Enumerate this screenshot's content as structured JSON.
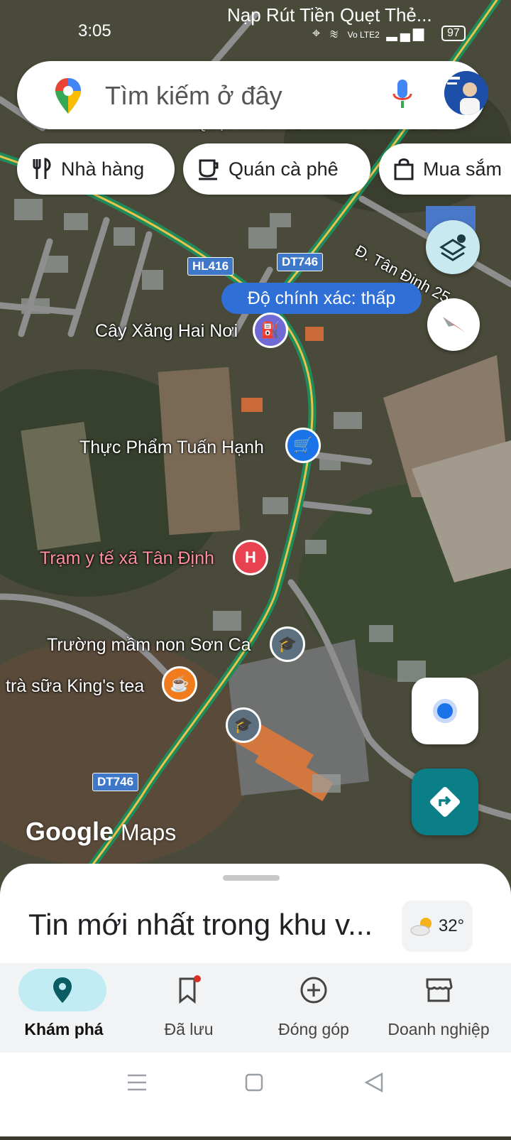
{
  "status_bar": {
    "time": "3:05",
    "notification": "Nạp Rút Tiền Quẹt Thẻ...",
    "battery": "97",
    "network": "Vo LTE2"
  },
  "search": {
    "placeholder": "Tìm kiếm ở đây"
  },
  "chips": [
    {
      "label": "Nhà hàng",
      "icon": "restaurant-icon"
    },
    {
      "label": "Quán cà phê",
      "icon": "coffee-icon"
    },
    {
      "label": "Mua sắm",
      "icon": "shopping-bag-icon"
    }
  ],
  "map": {
    "road_labels": [
      "HL416",
      "DT746",
      "DT746",
      "Đ. Tân Định 25"
    ],
    "accuracy": "Độ chính xác: thấp",
    "places": [
      {
        "name": "Cây Xăng Hai Nơi",
        "icon": "gas-station-icon"
      },
      {
        "name": "Thực Phẩm Tuấn Hạnh",
        "icon": "shopping-cart-icon"
      },
      {
        "name": "Trạm y tế xã Tân Định",
        "icon": "hospital-icon"
      },
      {
        "name": "Trường mầm non Sơn Ca",
        "icon": "school-icon"
      },
      {
        "name": "trà sữa King's tea",
        "icon": "cafe-icon"
      }
    ],
    "top_partial_label": "QUẠT TRƯỜNG TÂN PHƯỚNG UYÊN",
    "watermark_google": "Google",
    "watermark_maps": "Maps"
  },
  "sheet": {
    "title": "Tin mới nhất trong khu v...",
    "temperature": "32°",
    "weather_icon": "partly-sunny-icon"
  },
  "bottom_nav": [
    {
      "label": "Khám phá",
      "icon": "explore-pin-icon",
      "active": true
    },
    {
      "label": "Đã lưu",
      "icon": "bookmark-icon",
      "active": false
    },
    {
      "label": "Đóng góp",
      "icon": "add-circle-icon",
      "active": false
    },
    {
      "label": "Doanh nghiệp",
      "icon": "storefront-icon",
      "active": false
    }
  ],
  "colors": {
    "accent": "#2f6fd6",
    "teal": "#0b7f88",
    "nav_active": "#c2ecf3"
  }
}
